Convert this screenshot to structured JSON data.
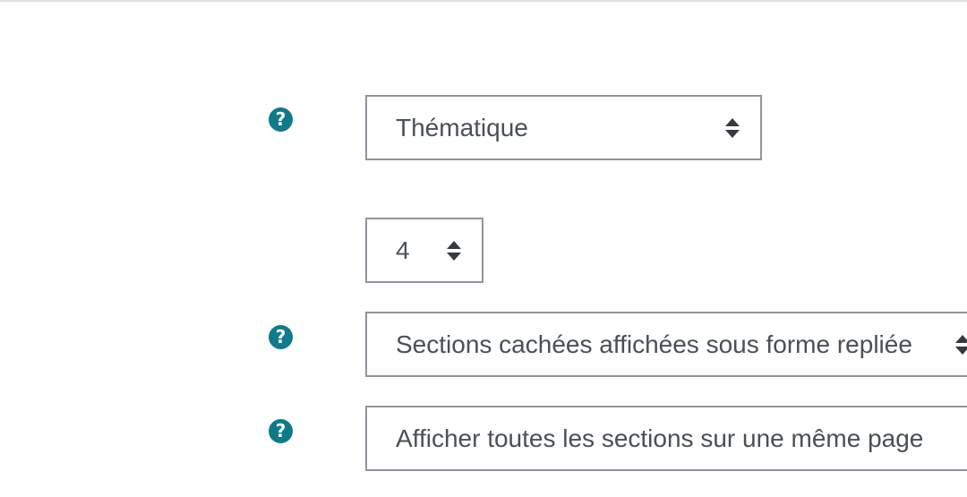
{
  "form": {
    "format": {
      "help_icon": "question-circle-icon",
      "value": "Thématique"
    },
    "sections_count": {
      "value": "4"
    },
    "hidden_sections": {
      "help_icon": "question-circle-icon",
      "value": "Sections cachées affichées sous forme repliée"
    },
    "course_layout": {
      "help_icon": "question-circle-icon",
      "value": "Afficher toutes les sections sur une même page"
    }
  },
  "colors": {
    "help_icon": "#0f7a8c",
    "border": "#8f959e",
    "text": "#495057"
  }
}
